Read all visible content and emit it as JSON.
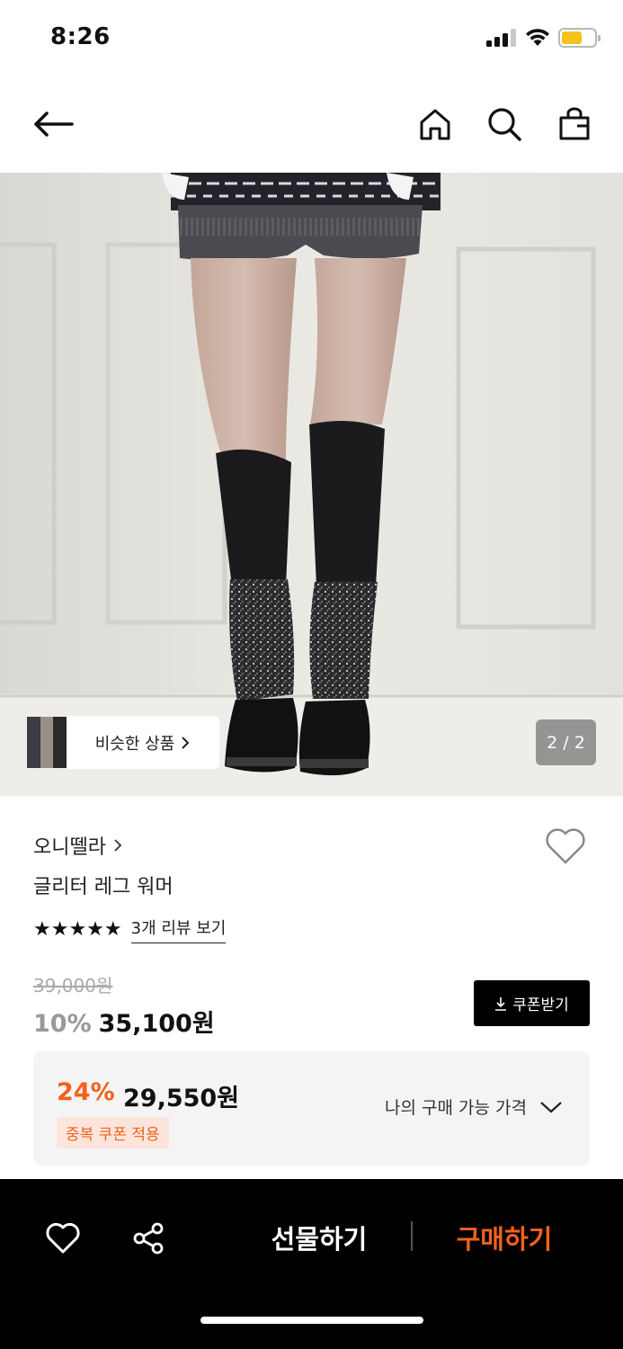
{
  "status_bar": {
    "time": "8:26"
  },
  "header": {
    "icons": [
      "back-arrow-icon",
      "home-icon",
      "search-icon",
      "shopping-bag-icon"
    ]
  },
  "gallery": {
    "similar_label": "비슷한 상품",
    "page_indicator": "2 / 2"
  },
  "product": {
    "brand": "오니뗄라",
    "name": "글리터 레그 워머",
    "stars": "★★★★★",
    "review_link": "3개 리뷰 보기",
    "original_price": "39,000원",
    "discount_rate": "10%",
    "sale_price": "35,100원",
    "coupon_label": "쿠폰받기"
  },
  "my_price": {
    "rate": "24%",
    "price": "29,550원",
    "badge": "중복 쿠폰 적용",
    "label": "나의 구매 가능 가격"
  },
  "bottom_bar": {
    "gift_label": "선물하기",
    "buy_label": "구매하기"
  },
  "colors": {
    "accent": "#f2621c",
    "battery": "#f4c21b"
  }
}
